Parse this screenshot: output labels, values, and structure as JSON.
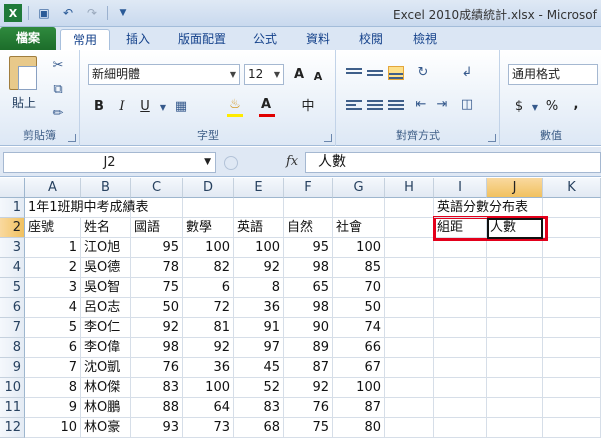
{
  "window": {
    "title": "Excel 2010成績統計.xlsx - Microsof"
  },
  "qat": {
    "icons": [
      "excel-icon",
      "save-icon",
      "undo-icon",
      "redo-icon",
      "customize-icon"
    ]
  },
  "tabs": [
    {
      "label": "檔案"
    },
    {
      "label": "常用"
    },
    {
      "label": "插入"
    },
    {
      "label": "版面配置"
    },
    {
      "label": "公式"
    },
    {
      "label": "資料"
    },
    {
      "label": "校閱"
    },
    {
      "label": "檢視"
    }
  ],
  "ribbon": {
    "clipboard": {
      "paste_label": "貼上",
      "group_label": "剪貼簿"
    },
    "font": {
      "font_name": "新細明體",
      "font_size": "12",
      "bold": "B",
      "italic": "I",
      "underline": "U",
      "grow": "A",
      "shrink": "A",
      "font_color_letter": "A",
      "phonetic": "中",
      "group_label": "字型"
    },
    "alignment": {
      "group_label": "對齊方式"
    },
    "number": {
      "format": "通用格式",
      "currency": "$",
      "percent": "%",
      "comma": ",",
      "group_label": "數值"
    }
  },
  "formula_bar": {
    "name_box": "J2",
    "fx": "fx",
    "value": "人數"
  },
  "columns": [
    "A",
    "B",
    "C",
    "D",
    "E",
    "F",
    "G",
    "H",
    "I",
    "J",
    "K"
  ],
  "selected_column": "J",
  "selected_row": "2",
  "rows": [
    {
      "n": "1",
      "cells": {
        "A": "1年1班期中考成績表",
        "I": "英語分數分布表"
      }
    },
    {
      "n": "2",
      "cells": {
        "A": "座號",
        "B": "姓名",
        "C": "國語",
        "D": "數學",
        "E": "英語",
        "F": "自然",
        "G": "社會",
        "I": "組距",
        "J": "人數"
      }
    },
    {
      "n": "3",
      "cells": {
        "A": "1",
        "B": "江O旭",
        "C": "95",
        "D": "100",
        "E": "100",
        "F": "95",
        "G": "100"
      }
    },
    {
      "n": "4",
      "cells": {
        "A": "2",
        "B": "吳O德",
        "C": "78",
        "D": "82",
        "E": "92",
        "F": "98",
        "G": "85"
      }
    },
    {
      "n": "5",
      "cells": {
        "A": "3",
        "B": "吳O智",
        "C": "75",
        "D": "6",
        "E": "8",
        "F": "65",
        "G": "70"
      }
    },
    {
      "n": "6",
      "cells": {
        "A": "4",
        "B": "呂O志",
        "C": "50",
        "D": "72",
        "E": "36",
        "F": "98",
        "G": "50"
      }
    },
    {
      "n": "7",
      "cells": {
        "A": "5",
        "B": "李O仁",
        "C": "92",
        "D": "81",
        "E": "91",
        "F": "90",
        "G": "74"
      }
    },
    {
      "n": "8",
      "cells": {
        "A": "6",
        "B": "李O偉",
        "C": "98",
        "D": "92",
        "E": "97",
        "F": "89",
        "G": "66"
      }
    },
    {
      "n": "9",
      "cells": {
        "A": "7",
        "B": "沈O凱",
        "C": "76",
        "D": "36",
        "E": "45",
        "F": "87",
        "G": "67"
      }
    },
    {
      "n": "10",
      "cells": {
        "A": "8",
        "B": "林O傑",
        "C": "83",
        "D": "100",
        "E": "52",
        "F": "92",
        "G": "100"
      }
    },
    {
      "n": "11",
      "cells": {
        "A": "9",
        "B": "林O鵬",
        "C": "88",
        "D": "64",
        "E": "83",
        "F": "76",
        "G": "87"
      }
    },
    {
      "n": "12",
      "cells": {
        "A": "10",
        "B": "林O豪",
        "C": "93",
        "D": "73",
        "E": "68",
        "F": "75",
        "G": "80"
      }
    }
  ]
}
